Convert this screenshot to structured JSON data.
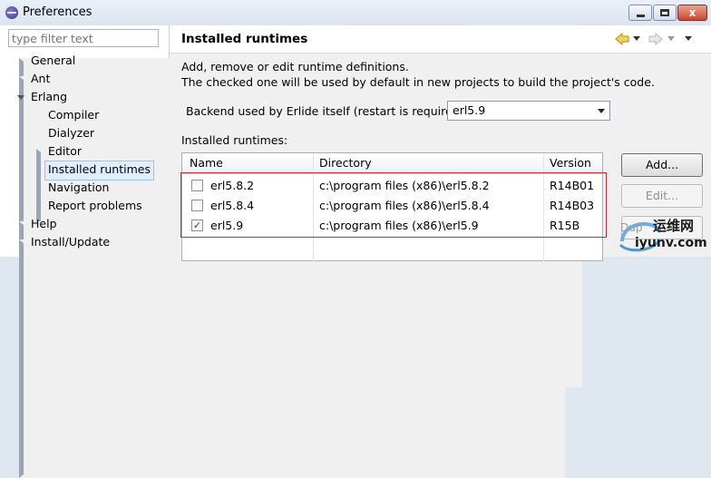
{
  "window": {
    "title": "Preferences",
    "min_label": "",
    "max_label": "",
    "close_label": "x"
  },
  "sidebar": {
    "filter_placeholder": "type filter text",
    "items": [
      {
        "label": "General"
      },
      {
        "label": "Ant"
      },
      {
        "label": "Erlang"
      },
      {
        "label": "Compiler"
      },
      {
        "label": "Dialyzer"
      },
      {
        "label": "Editor"
      },
      {
        "label": "Installed runtimes"
      },
      {
        "label": "Navigation"
      },
      {
        "label": "Report problems"
      },
      {
        "label": "Help"
      },
      {
        "label": "Install/Update"
      }
    ]
  },
  "page": {
    "title": "Installed runtimes",
    "description_line1": "Add, remove or edit runtime definitions.",
    "description_line2": "The checked one will be used by default in new projects to build the project's code.",
    "backend_label": "Backend used by Erlide itself (restart is required)",
    "backend_value": "erl5.9",
    "table_label": "Installed runtimes:",
    "columns": [
      "Name",
      "Directory",
      "Version"
    ],
    "rows": [
      {
        "checked": false,
        "name": "erl5.8.2",
        "directory": "c:\\program files (x86)\\erl5.8.2",
        "version": "R14B01"
      },
      {
        "checked": false,
        "name": "erl5.8.4",
        "directory": "c:\\program files (x86)\\erl5.8.4",
        "version": "R14B03"
      },
      {
        "checked": true,
        "name": "erl5.9",
        "directory": "c:\\program files (x86)\\erl5.9",
        "version": "R15B"
      }
    ],
    "buttons": {
      "add": "Add...",
      "edit": "Edit...",
      "duplicate": "Dup"
    }
  },
  "watermark": {
    "cn": "运维网",
    "site": "iyunv.com"
  },
  "colors": {
    "highlight_box": "#d4242c",
    "selection": "#dfeeff"
  }
}
